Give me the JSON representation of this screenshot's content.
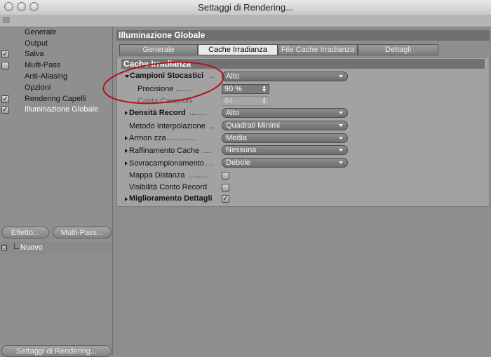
{
  "window": {
    "title": "Settaggi di Rendering..."
  },
  "sidebar": {
    "items": [
      {
        "label": "Generale",
        "checked": false,
        "has_checkbox": false
      },
      {
        "label": "Output",
        "checked": false,
        "has_checkbox": false
      },
      {
        "label": "Salva",
        "checked": true,
        "has_checkbox": true
      },
      {
        "label": "Multi-Pass",
        "checked": false,
        "has_checkbox": true
      },
      {
        "label": "Anti-Aliasing",
        "checked": false,
        "has_checkbox": false
      },
      {
        "label": "Opzioni",
        "checked": false,
        "has_checkbox": false
      },
      {
        "label": "Rendering Capelli",
        "checked": true,
        "has_checkbox": true
      },
      {
        "label": "Illuminazione Globale",
        "checked": true,
        "has_checkbox": true,
        "active": true
      }
    ],
    "effect_button": "Effetto...",
    "multipass_button": "Multi-Pass...",
    "preset_item": "Nuovo",
    "bottom_button": "Settaggi di Rendering..."
  },
  "panel": {
    "title": "Illuminazione Globale",
    "tabs": [
      {
        "label": "Generale",
        "active": false
      },
      {
        "label": "Cache Irradianza",
        "active": true
      },
      {
        "label": "File Cache Irradianza",
        "active": false
      },
      {
        "label": "Dettagli",
        "active": false
      }
    ],
    "section_title": "Cache Irradianza",
    "rows": {
      "campioni_stocastici": {
        "label": "Campioni Stocastici",
        "dots": "..",
        "value": "Alto"
      },
      "precisione": {
        "label": "Precisione",
        "dots": "........",
        "value": "90 %"
      },
      "conta_campioni": {
        "label": "Conta Campioni",
        "value": "64"
      },
      "densita_record": {
        "label": "Densità Record",
        "dots": "........",
        "value": "Alto"
      },
      "metodo_interpolazione": {
        "label": "Metodo Interpolazione",
        "dots": "..",
        "value": "Quadrati Minimi"
      },
      "armonizza": {
        "label": "Armon zza",
        "dots": "..............",
        "value": "Media"
      },
      "raffinamento_cache": {
        "label": "Raffinamento Cache",
        "dots": "....",
        "value": "Nessuna"
      },
      "sovracampionamento": {
        "label": "Sovracampionamento",
        "dots": "....",
        "value": "Debole"
      },
      "mappa_distanza": {
        "label": "Mappa Distanza",
        "dots": ".........",
        "checked": false
      },
      "visibilita_conto_record": {
        "label": "Visibilità Conto Record",
        "checked": false
      },
      "miglioramento_dettagli": {
        "label": "Miglioramento Dettagli",
        "checked": true
      }
    }
  },
  "annotation": {
    "color": "#b5121b"
  }
}
